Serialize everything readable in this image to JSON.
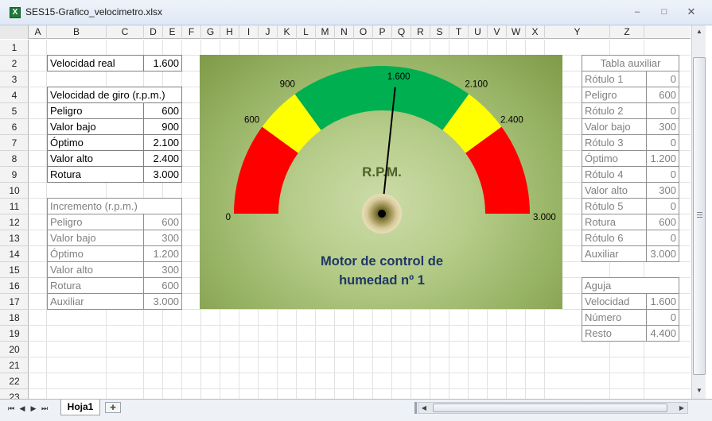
{
  "window": {
    "icon_label": "X",
    "title": "SES15-Grafico_velocimetro.xlsx",
    "minimize": "–",
    "maximize": "□",
    "close": "✕"
  },
  "columns": [
    "A",
    "B",
    "C",
    "D",
    "E",
    "F",
    "G",
    "H",
    "I",
    "J",
    "K",
    "L",
    "M",
    "N",
    "O",
    "P",
    "Q",
    "R",
    "S",
    "T",
    "U",
    "V",
    "W",
    "X",
    "Y",
    "Z"
  ],
  "rows": [
    "1",
    "2",
    "3",
    "4",
    "5",
    "6",
    "7",
    "8",
    "9",
    "10",
    "11",
    "12",
    "13",
    "14",
    "15",
    "16",
    "17",
    "18",
    "19",
    "20",
    "21",
    "22",
    "23"
  ],
  "speed_table": {
    "label": "Velocidad real",
    "value": "1.600"
  },
  "rpm_table": {
    "header": "Velocidad de giro (r.p.m.)",
    "rows": [
      {
        "label": "Peligro",
        "value": "600"
      },
      {
        "label": "Valor bajo",
        "value": "900"
      },
      {
        "label": "Óptimo",
        "value": "2.100"
      },
      {
        "label": "Valor alto",
        "value": "2.400"
      },
      {
        "label": "Rotura",
        "value": "3.000"
      }
    ]
  },
  "increment_table": {
    "header": "Incremento (r.p.m.)",
    "rows": [
      {
        "label": "Peligro",
        "value": "600"
      },
      {
        "label": "Valor bajo",
        "value": "300"
      },
      {
        "label": "Óptimo",
        "value": "1.200"
      },
      {
        "label": "Valor alto",
        "value": "300"
      },
      {
        "label": "Rotura",
        "value": "600"
      },
      {
        "label": "Auxiliar",
        "value": "3.000"
      }
    ]
  },
  "aux_table": {
    "header": "Tabla auxiliar",
    "rows": [
      {
        "label": "Rótulo 1",
        "value": "0"
      },
      {
        "label": "Peligro",
        "value": "600"
      },
      {
        "label": "Rótulo 2",
        "value": "0"
      },
      {
        "label": "Valor bajo",
        "value": "300"
      },
      {
        "label": "Rótulo 3",
        "value": "0"
      },
      {
        "label": "Óptimo",
        "value": "1.200"
      },
      {
        "label": "Rótulo 4",
        "value": "0"
      },
      {
        "label": "Valor alto",
        "value": "300"
      },
      {
        "label": "Rótulo 5",
        "value": "0"
      },
      {
        "label": "Rotura",
        "value": "600"
      },
      {
        "label": "Rótulo 6",
        "value": "0"
      },
      {
        "label": "Auxiliar",
        "value": "3.000"
      }
    ]
  },
  "needle_table": {
    "header": "Aguja",
    "rows": [
      {
        "label": "Velocidad",
        "value": "1.600"
      },
      {
        "label": "Número",
        "value": "0"
      },
      {
        "label": "Resto",
        "value": "4.400"
      }
    ]
  },
  "chart_data": {
    "type": "gauge",
    "title": "Motor de control de humedad nº 1",
    "unit_label": "R.P.M.",
    "min": 0,
    "max": 3000,
    "needle_value": 1600,
    "needle_label": "1.600",
    "bands": [
      {
        "name": "Peligro",
        "from": 0,
        "to": 600,
        "color": "#ff0000"
      },
      {
        "name": "Valor bajo",
        "from": 600,
        "to": 900,
        "color": "#ffff00"
      },
      {
        "name": "Óptimo",
        "from": 900,
        "to": 2100,
        "color": "#00b050"
      },
      {
        "name": "Valor alto",
        "from": 2100,
        "to": 2400,
        "color": "#ffff00"
      },
      {
        "name": "Rotura",
        "from": 2400,
        "to": 3000,
        "color": "#ff0000"
      }
    ],
    "ticks": [
      {
        "value": 0,
        "label": "0"
      },
      {
        "value": 600,
        "label": "600"
      },
      {
        "value": 900,
        "label": "900"
      },
      {
        "value": 2100,
        "label": "2.100"
      },
      {
        "value": 2400,
        "label": "2.400"
      },
      {
        "value": 3000,
        "label": "3.000"
      }
    ]
  },
  "sheet_tab": "Hoja1",
  "colors": {
    "title_text": "#1f3864",
    "rpm_text": "#4f6228"
  }
}
